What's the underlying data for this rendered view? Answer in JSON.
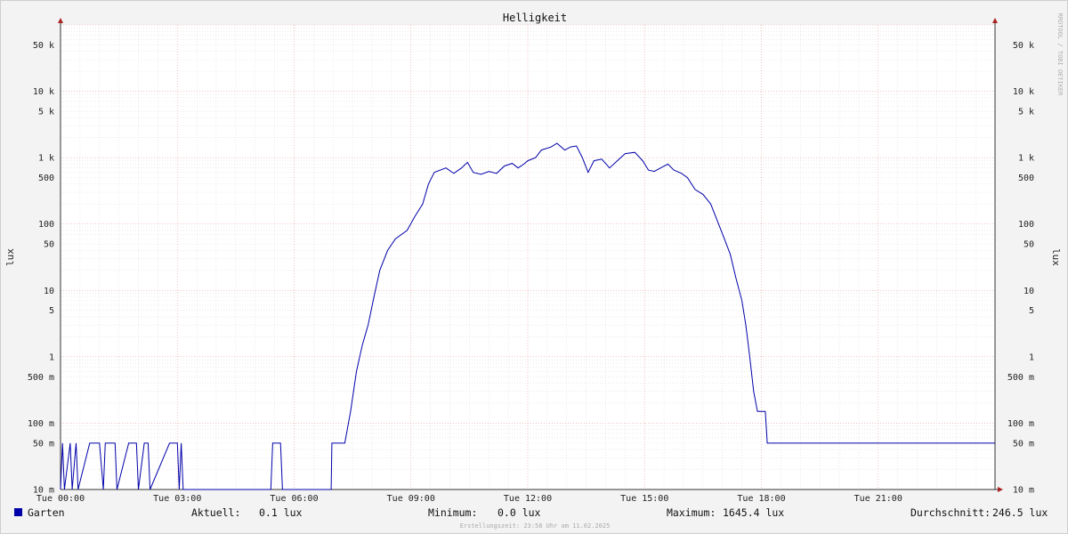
{
  "chart_data": {
    "type": "line",
    "title": "Helligkeit",
    "ylabel": "lux",
    "scale": "log",
    "ylim": [
      10,
      100000
    ],
    "y_ticks": [
      {
        "v": 10,
        "label": "10 m"
      },
      {
        "v": 50,
        "label": "50 m"
      },
      {
        "v": 100,
        "label": "100 m"
      },
      {
        "v": 500,
        "label": "500 m"
      },
      {
        "v": 1000,
        "label": "1"
      },
      {
        "v": 5000,
        "label": "5"
      },
      {
        "v": 10000,
        "label": "10"
      },
      {
        "v": 50000,
        "label": "50"
      },
      {
        "v": 100000,
        "label": "100"
      },
      {
        "v": 500000,
        "label": "500"
      },
      {
        "v": 1000000,
        "label": "1 k"
      },
      {
        "v": 5000000,
        "label": "5 k"
      },
      {
        "v": 10000000,
        "label": "10 k"
      },
      {
        "v": 50000000,
        "label": "50 k"
      }
    ],
    "x_ticks": [
      "Tue 00:00",
      "Tue 03:00",
      "Tue 06:00",
      "Tue 09:00",
      "Tue 12:00",
      "Tue 15:00",
      "Tue 18:00",
      "Tue 21:00"
    ],
    "x_range_hours": [
      0,
      24
    ],
    "grid": true,
    "series": [
      {
        "name": "Garten",
        "color": "#0000aa",
        "unit": "mlux",
        "points": [
          [
            0.0,
            10
          ],
          [
            0.05,
            50
          ],
          [
            0.1,
            10
          ],
          [
            0.25,
            50
          ],
          [
            0.3,
            10
          ],
          [
            0.4,
            50
          ],
          [
            0.45,
            10
          ],
          [
            0.75,
            50
          ],
          [
            1.0,
            50
          ],
          [
            1.1,
            10
          ],
          [
            1.15,
            50
          ],
          [
            1.4,
            50
          ],
          [
            1.45,
            10
          ],
          [
            1.75,
            50
          ],
          [
            1.95,
            50
          ],
          [
            2.0,
            10
          ],
          [
            2.15,
            50
          ],
          [
            2.25,
            50
          ],
          [
            2.3,
            10
          ],
          [
            2.8,
            50
          ],
          [
            3.0,
            50
          ],
          [
            3.05,
            10
          ],
          [
            3.1,
            50
          ],
          [
            3.15,
            10
          ],
          [
            5.4,
            10
          ],
          [
            5.45,
            50
          ],
          [
            5.65,
            50
          ],
          [
            5.7,
            10
          ],
          [
            6.95,
            10
          ],
          [
            6.97,
            50
          ],
          [
            7.3,
            50
          ],
          [
            7.45,
            150
          ],
          [
            7.6,
            600
          ],
          [
            7.75,
            1500
          ],
          [
            7.9,
            3000
          ],
          [
            8.05,
            8000
          ],
          [
            8.2,
            20000
          ],
          [
            8.4,
            40000
          ],
          [
            8.6,
            60000
          ],
          [
            8.9,
            80000
          ],
          [
            9.1,
            130000
          ],
          [
            9.3,
            200000
          ],
          [
            9.45,
            400000
          ],
          [
            9.6,
            600000
          ],
          [
            9.9,
            700000
          ],
          [
            10.1,
            580000
          ],
          [
            10.3,
            700000
          ],
          [
            10.45,
            850000
          ],
          [
            10.6,
            600000
          ],
          [
            10.8,
            560000
          ],
          [
            11.0,
            620000
          ],
          [
            11.2,
            580000
          ],
          [
            11.4,
            750000
          ],
          [
            11.6,
            820000
          ],
          [
            11.75,
            700000
          ],
          [
            11.9,
            800000
          ],
          [
            12.0,
            900000
          ],
          [
            12.2,
            1000000
          ],
          [
            12.35,
            1300000
          ],
          [
            12.6,
            1450000
          ],
          [
            12.75,
            1645400
          ],
          [
            12.95,
            1300000
          ],
          [
            13.1,
            1450000
          ],
          [
            13.25,
            1500000
          ],
          [
            13.4,
            1000000
          ],
          [
            13.55,
            600000
          ],
          [
            13.7,
            900000
          ],
          [
            13.9,
            950000
          ],
          [
            14.1,
            700000
          ],
          [
            14.3,
            900000
          ],
          [
            14.5,
            1150000
          ],
          [
            14.75,
            1200000
          ],
          [
            14.95,
            900000
          ],
          [
            15.1,
            650000
          ],
          [
            15.25,
            620000
          ],
          [
            15.45,
            720000
          ],
          [
            15.6,
            800000
          ],
          [
            15.75,
            650000
          ],
          [
            15.95,
            580000
          ],
          [
            16.1,
            500000
          ],
          [
            16.3,
            330000
          ],
          [
            16.5,
            280000
          ],
          [
            16.7,
            200000
          ],
          [
            16.9,
            100000
          ],
          [
            17.05,
            60000
          ],
          [
            17.2,
            35000
          ],
          [
            17.35,
            15000
          ],
          [
            17.5,
            7000
          ],
          [
            17.6,
            3000
          ],
          [
            17.7,
            1000
          ],
          [
            17.8,
            300
          ],
          [
            17.9,
            150
          ],
          [
            18.1,
            150
          ],
          [
            18.15,
            50
          ],
          [
            24.0,
            50
          ]
        ]
      }
    ]
  },
  "legend": {
    "series_name": "Garten",
    "color": "#0000aa",
    "aktuell_label": "Aktuell:",
    "aktuell_value": "0.1 lux",
    "minimum_label": "Minimum:",
    "minimum_value": "0.0 lux",
    "maximum_label": "Maximum:",
    "maximum_value": "1645.4 lux",
    "durchschnitt_label": "Durchschnitt:",
    "durchschnitt_value": "246.5 lux"
  },
  "footer": "Erstellungszeit: 23:58 Uhr am 11.02.2025",
  "watermark": "RRDTOOL / TOBI OETIKER"
}
